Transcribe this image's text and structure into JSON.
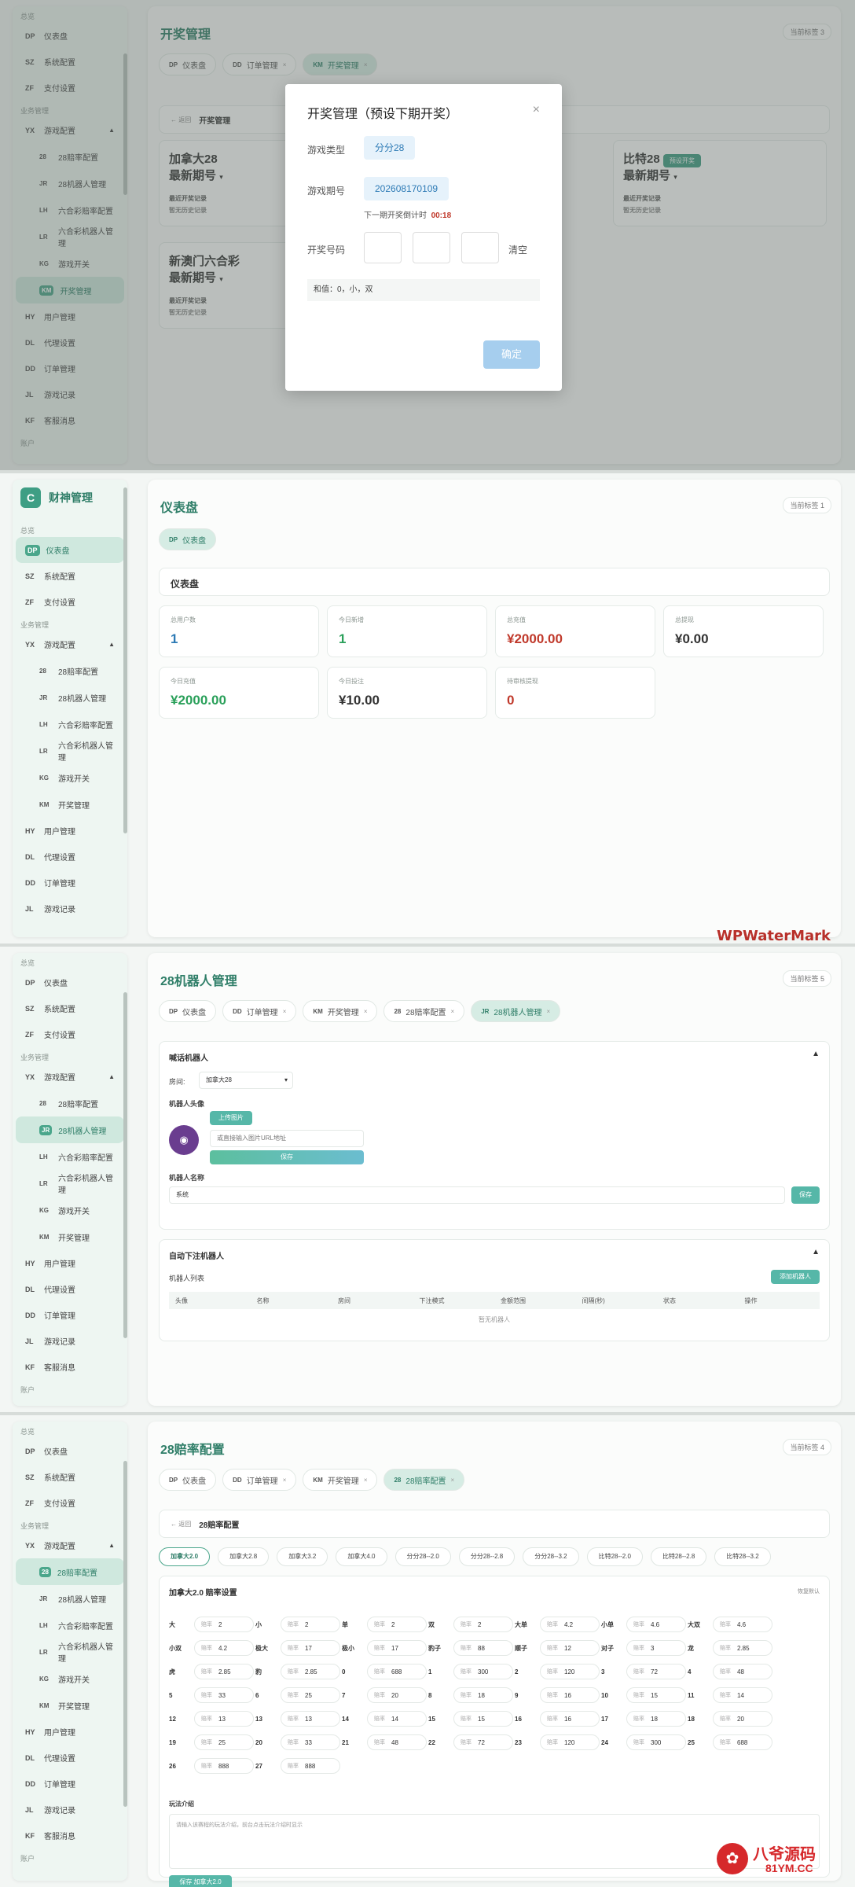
{
  "sidebar": {
    "brand_letter": "C",
    "brand_title": "财神管理",
    "group_overview": "总览",
    "group_business": "业务管理",
    "group_account": "账户",
    "items": [
      {
        "ab": "DP",
        "label": "仪表盘"
      },
      {
        "ab": "SZ",
        "label": "系统配置"
      },
      {
        "ab": "ZF",
        "label": "支付设置"
      },
      {
        "ab": "YX",
        "label": "游戏配置"
      },
      {
        "ab": "28",
        "label": "28赔率配置"
      },
      {
        "ab": "JR",
        "label": "28机器人管理"
      },
      {
        "ab": "LH",
        "label": "六合彩赔率配置"
      },
      {
        "ab": "LR",
        "label": "六合彩机器人管理"
      },
      {
        "ab": "KG",
        "label": "游戏开关"
      },
      {
        "ab": "KM",
        "label": "开奖管理"
      },
      {
        "ab": "HY",
        "label": "用户管理"
      },
      {
        "ab": "DL",
        "label": "代理设置"
      },
      {
        "ab": "DD",
        "label": "订单管理"
      },
      {
        "ab": "JL",
        "label": "游戏记录"
      },
      {
        "ab": "KF",
        "label": "客服消息"
      }
    ]
  },
  "panel1": {
    "title": "开奖管理",
    "tab_count": "当前标签 3",
    "tabs": [
      {
        "ab": "DP",
        "label": "仪表盘"
      },
      {
        "ab": "DD",
        "label": "订单管理"
      },
      {
        "ab": "KM",
        "label": "开奖管理"
      }
    ],
    "back": "← 返回",
    "bar_title": "开奖管理",
    "games": [
      {
        "name": "加拿大28",
        "latest": "最新期号",
        "recent": "最近开奖记录",
        "empty": "暂无历史记录"
      },
      {
        "name": "新澳门六合彩",
        "latest": "最新期号",
        "recent": "最近开奖记录",
        "empty": "暂无历史记录"
      },
      {
        "name": "比特28",
        "latest": "最新期号",
        "recent": "最近开奖记录",
        "empty": "暂无历史记录",
        "preset": "预设开奖"
      }
    ],
    "modal": {
      "title": "开奖管理（预设下期开奖）",
      "close": "×",
      "type_label": "游戏类型",
      "type_value": "分分28",
      "period_label": "游戏期号",
      "period_value": "202608170109",
      "countdown_label": "下一期开奖倒计时",
      "countdown_value": "00:18",
      "code_label": "开奖号码",
      "clear": "清空",
      "sum_text": "和值：0，小，双",
      "confirm": "确定"
    }
  },
  "panel2": {
    "title": "仪表盘",
    "tab_count": "当前标签 1",
    "tabs": [
      {
        "ab": "DP",
        "label": "仪表盘"
      }
    ],
    "section": "仪表盘",
    "stats": [
      {
        "label": "总用户数",
        "value": "1",
        "color": "#2d7ab5"
      },
      {
        "label": "今日新增",
        "value": "1",
        "color": "#2aa05a"
      },
      {
        "label": "总充值",
        "value": "¥2000.00",
        "color": "#c0392b"
      },
      {
        "label": "总提现",
        "value": "¥0.00",
        "color": "#333333"
      },
      {
        "label": "今日充值",
        "value": "¥2000.00",
        "color": "#2aa05a"
      },
      {
        "label": "今日投注",
        "value": "¥10.00",
        "color": "#333333"
      },
      {
        "label": "待审核提现",
        "value": "0",
        "color": "#c0392b"
      }
    ]
  },
  "watermark": "WPWaterMark",
  "panel3": {
    "title": "28机器人管理",
    "tab_count": "当前标签 5",
    "tabs": [
      {
        "ab": "DP",
        "label": "仪表盘"
      },
      {
        "ab": "DD",
        "label": "订单管理"
      },
      {
        "ab": "KM",
        "label": "开奖管理"
      },
      {
        "ab": "28",
        "label": "28赔率配置"
      },
      {
        "ab": "JR",
        "label": "28机器人管理"
      }
    ],
    "sec1_title": "喊话机器人",
    "room_label": "房间:",
    "room_value": "加拿大28",
    "avatar_label": "机器人头像",
    "upload": "上传图片",
    "url_placeholder": "或直接输入图片URL地址",
    "save": "保存",
    "name_label": "机器人名称",
    "name_value": "系统",
    "save2": "保存",
    "sec2_title": "自动下注机器人",
    "list_label": "机器人列表",
    "add": "添加机器人",
    "cols": [
      "头像",
      "名称",
      "房间",
      "下注模式",
      "金额范围",
      "间隔(秒)",
      "状态",
      "操作"
    ],
    "empty": "暂无机器人"
  },
  "panel4": {
    "title": "28赔率配置",
    "tab_count": "当前标签 4",
    "tabs": [
      {
        "ab": "DP",
        "label": "仪表盘"
      },
      {
        "ab": "DD",
        "label": "订单管理"
      },
      {
        "ab": "KM",
        "label": "开奖管理"
      },
      {
        "ab": "28",
        "label": "28赔率配置"
      }
    ],
    "back": "← 返回",
    "bar_title": "28赔率配置",
    "ptabs": [
      "加拿大2.0",
      "加拿大2.8",
      "加拿大3.2",
      "加拿大4.0",
      "分分28--2.0",
      "分分28--2.8",
      "分分28--3.2",
      "比特28--2.0",
      "比特28--2.8",
      "比特28--3.2"
    ],
    "section": "加拿大2.0 赔率设置",
    "reset": "恢复默认",
    "hint": "赔率",
    "odds": [
      [
        "大",
        "2"
      ],
      [
        "小",
        "2"
      ],
      [
        "单",
        "2"
      ],
      [
        "双",
        "2"
      ],
      [
        "大单",
        "4.2"
      ],
      [
        "小单",
        "4.6"
      ],
      [
        "大双",
        "4.6"
      ],
      [
        "小双",
        "4.2"
      ],
      [
        "极大",
        "17"
      ],
      [
        "极小",
        "17"
      ],
      [
        "豹子",
        "88"
      ],
      [
        "顺子",
        "12"
      ],
      [
        "对子",
        "3"
      ],
      [
        "龙",
        "2.85"
      ],
      [
        "虎",
        "2.85"
      ],
      [
        "豹",
        "2.85"
      ],
      [
        "0",
        "688"
      ],
      [
        "1",
        "300"
      ],
      [
        "2",
        "120"
      ],
      [
        "3",
        "72"
      ],
      [
        "4",
        "48"
      ],
      [
        "5",
        "33"
      ],
      [
        "6",
        "25"
      ],
      [
        "7",
        "20"
      ],
      [
        "8",
        "18"
      ],
      [
        "9",
        "16"
      ],
      [
        "10",
        "15"
      ],
      [
        "11",
        "14"
      ],
      [
        "12",
        "13"
      ],
      [
        "13",
        "13"
      ],
      [
        "14",
        "14"
      ],
      [
        "15",
        "15"
      ],
      [
        "16",
        "16"
      ],
      [
        "17",
        "18"
      ],
      [
        "18",
        "20"
      ],
      [
        "19",
        "25"
      ],
      [
        "20",
        "33"
      ],
      [
        "21",
        "48"
      ],
      [
        "22",
        "72"
      ],
      [
        "23",
        "120"
      ],
      [
        "24",
        "300"
      ],
      [
        "25",
        "688"
      ],
      [
        "26",
        "888"
      ],
      [
        "27",
        "888"
      ]
    ],
    "intro_label": "玩法介绍",
    "intro_placeholder": "请输入该赛程的玩法介绍，前台点击玩法介绍时显示",
    "save": "保存 加拿大2.0"
  },
  "corner_logo": {
    "text": "八爷源码",
    "url": "81YM.CC"
  }
}
